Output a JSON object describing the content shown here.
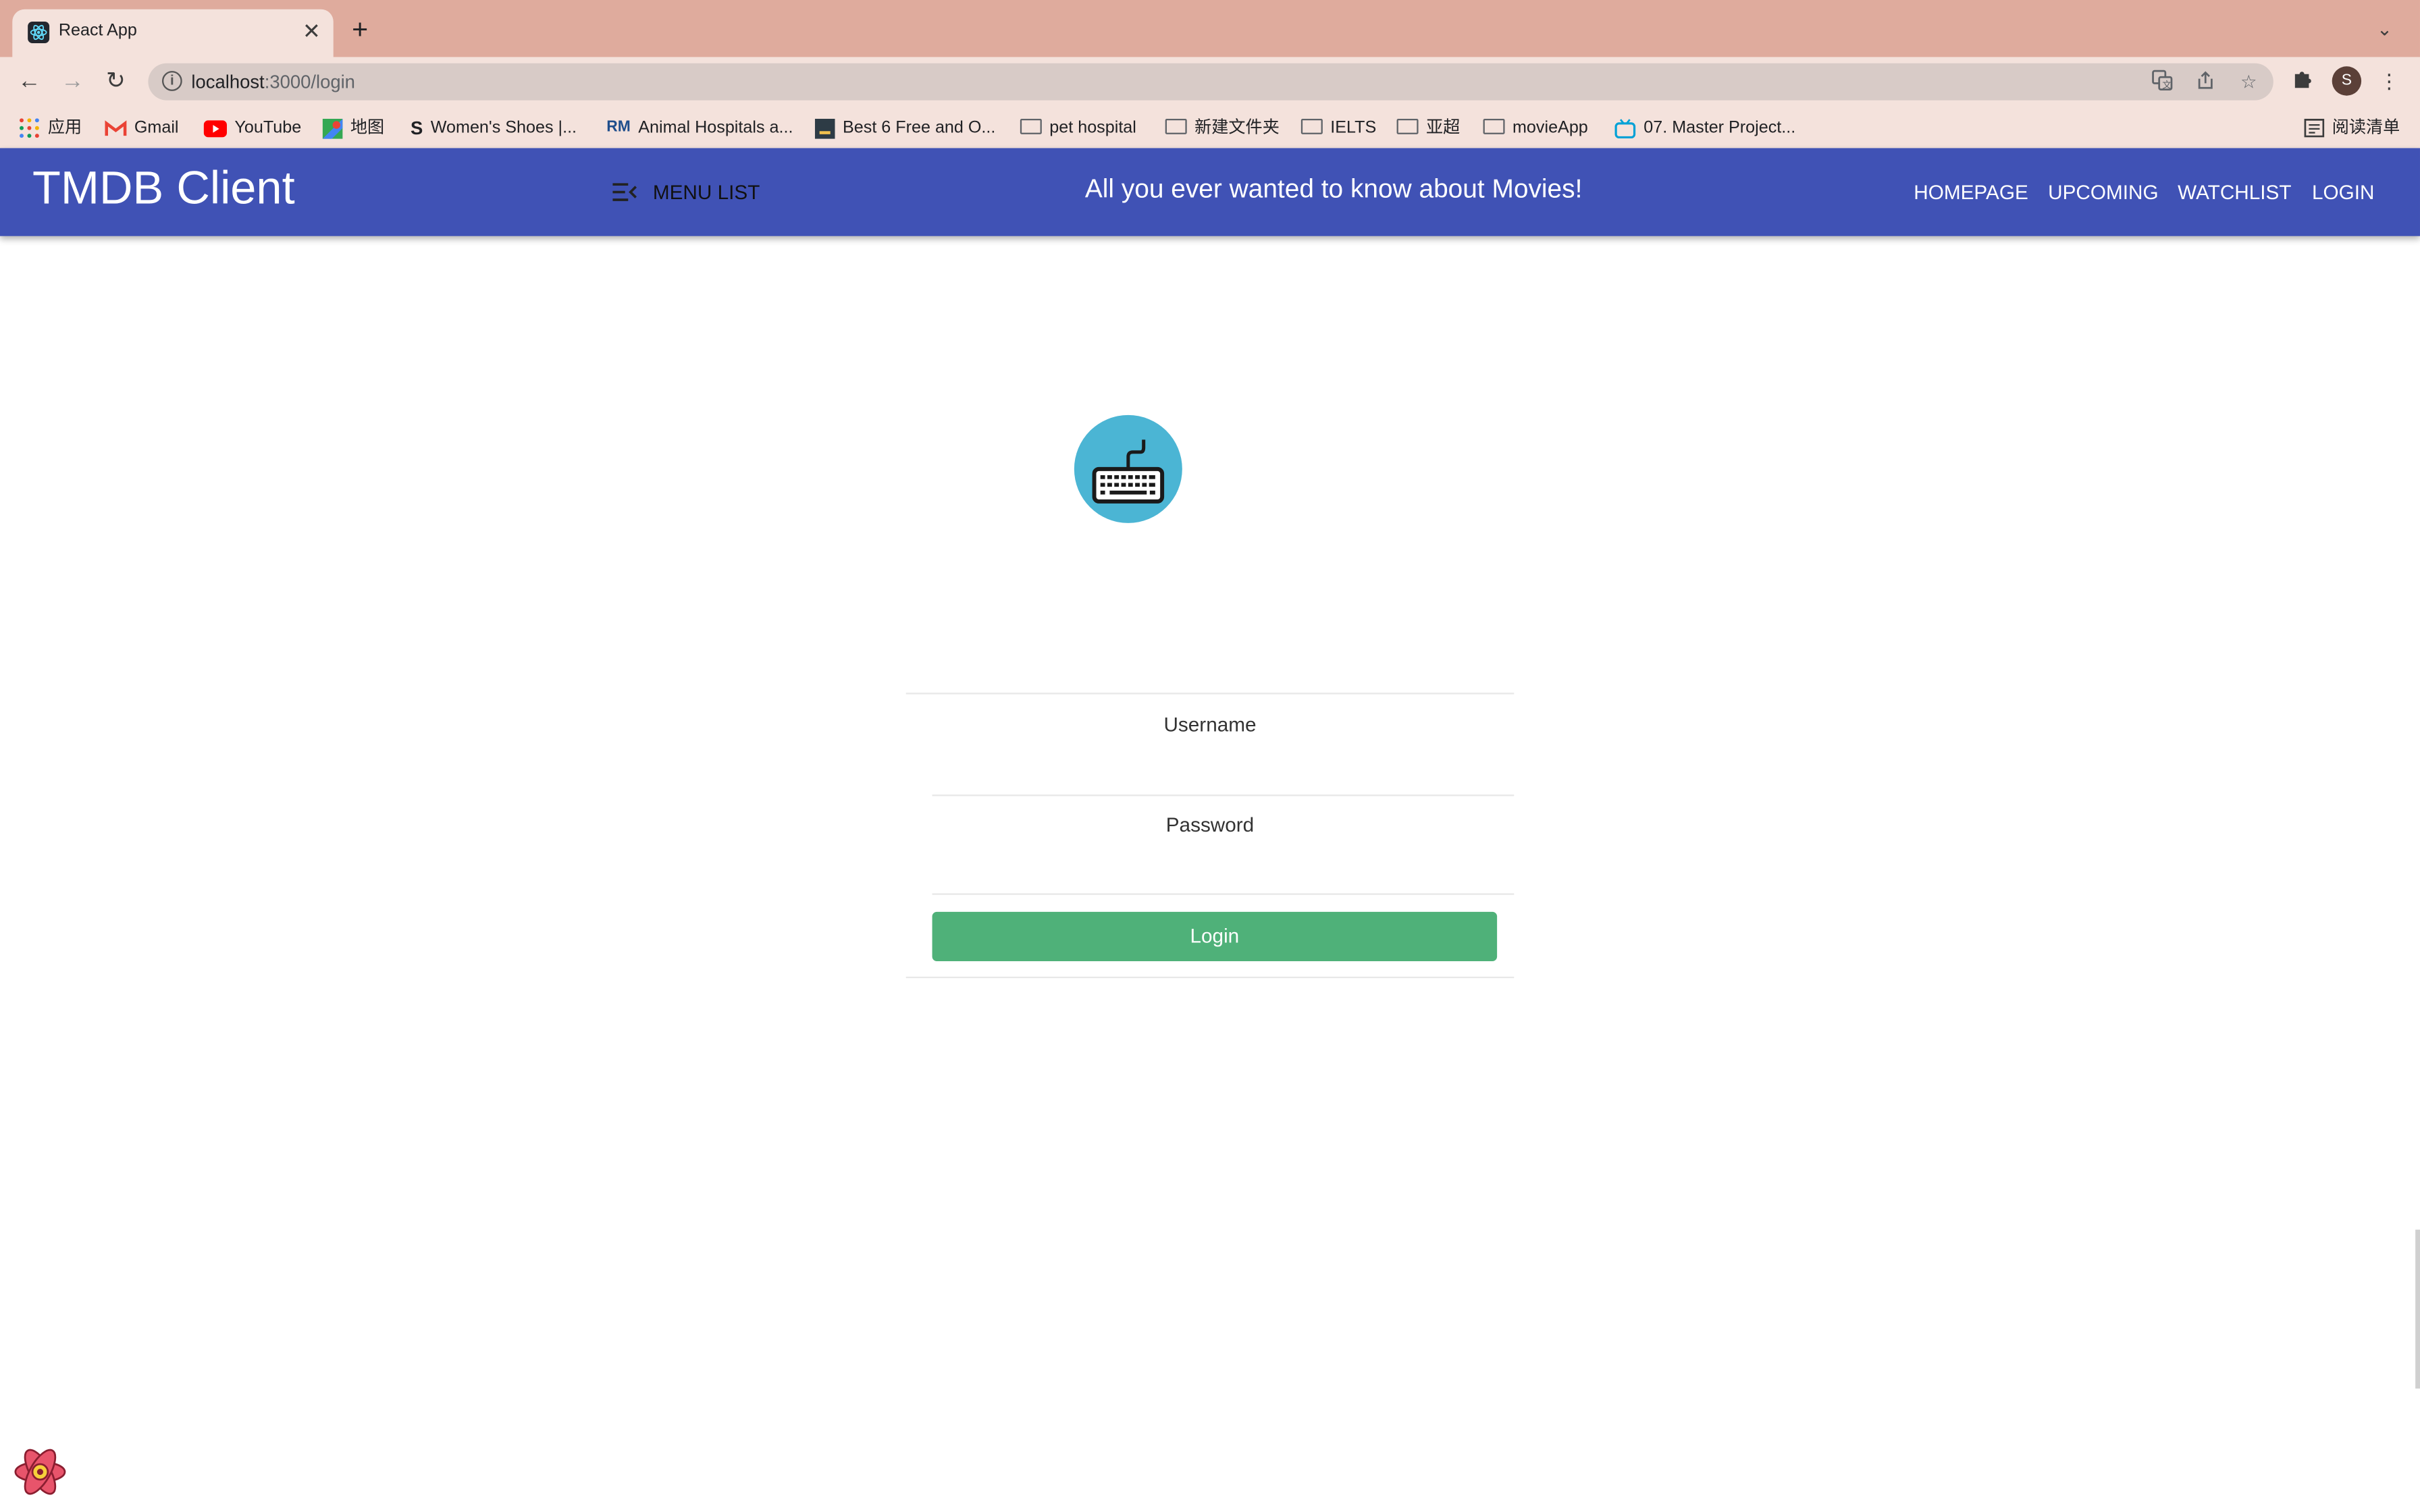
{
  "browser": {
    "tab_title": "React App",
    "url_host": "localhost",
    "url_rest": ":3000/login",
    "profile_initial": "S",
    "icons": [
      "react-favicon",
      "close-icon",
      "plus-icon",
      "chevron-down-icon",
      "back-icon",
      "forward-icon",
      "reload-icon",
      "info-icon",
      "translate-icon",
      "share-icon",
      "star-icon",
      "extensions-icon",
      "more-icon"
    ]
  },
  "bookmarks": [
    {
      "label": "应用",
      "icon": "apps-grid-icon"
    },
    {
      "label": "Gmail",
      "icon": "gmail-icon"
    },
    {
      "label": "YouTube",
      "icon": "youtube-icon"
    },
    {
      "label": "地图",
      "icon": "maps-icon"
    },
    {
      "label": "Women's Shoes |...",
      "icon": "s-logo-icon"
    },
    {
      "label": "Animal Hospitals a...",
      "icon": "rm-logo-icon"
    },
    {
      "label": "Best 6 Free and O...",
      "icon": "site-icon"
    },
    {
      "label": "pet hospital",
      "icon": "folder-icon"
    },
    {
      "label": "新建文件夹",
      "icon": "folder-icon"
    },
    {
      "label": "IELTS",
      "icon": "folder-icon"
    },
    {
      "label": "亚超",
      "icon": "folder-icon"
    },
    {
      "label": "movieApp",
      "icon": "folder-icon"
    },
    {
      "label": "07. Master Project...",
      "icon": "bilibili-icon"
    }
  ],
  "reading_list": "阅读清单",
  "header": {
    "brand": "TMDB Client",
    "menu_label": "MENU LIST",
    "tagline": "All you ever wanted to know about Movies!",
    "nav": [
      "HOMEPAGE",
      "UPCOMING",
      "WATCHLIST",
      "LOGIN"
    ],
    "bar_color": "#4052b5"
  },
  "login": {
    "avatar_icon": "keyboard-icon",
    "avatar_color": "#4bb5d4",
    "username_label": "Username",
    "username_value": "",
    "password_label": "Password",
    "password_value": "",
    "button_label": "Login",
    "button_color": "#4fb179"
  }
}
